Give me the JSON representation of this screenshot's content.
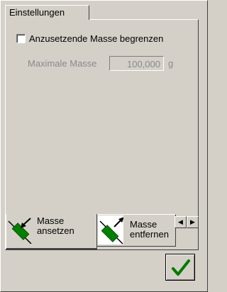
{
  "top_tab": {
    "label": "Einstellungen"
  },
  "settings": {
    "limit_checkbox_label": "Anzusetzende Masse begrenzen",
    "limit_checked": false,
    "max_mass_label": "Maximale Masse",
    "max_mass_value": "100,000",
    "max_mass_unit": "g"
  },
  "bottom_tabs": [
    {
      "line1": "Masse",
      "line2": "ansetzen",
      "icon": "add-mass-icon",
      "active": true
    },
    {
      "line1": "Masse",
      "line2": "entfernen",
      "icon": "remove-mass-icon",
      "active": false
    }
  ],
  "scroll": {
    "left_glyph": "◀",
    "right_glyph": "▶"
  },
  "ok_button": {
    "icon": "checkmark-icon"
  },
  "colors": {
    "icon_green": "#008000",
    "check_green": "#007a00",
    "face": "#d4d0c8"
  }
}
